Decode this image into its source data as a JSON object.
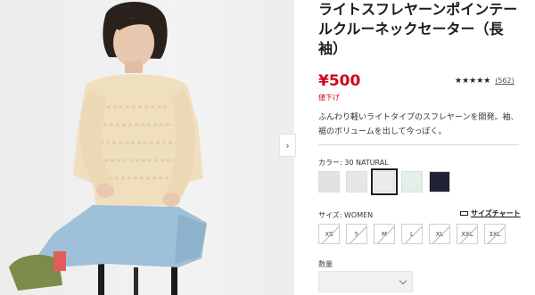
{
  "product": {
    "title": "ライトスフレヤーンポインテールクルーネックセーター（長袖）",
    "price": "¥500",
    "price_tag": "値下げ",
    "rating_stars": "★★★★★",
    "rating_count": "(562)",
    "description": "ふんわり軽いライトタイプのスフレヤーンを開発。袖、裾のボリュームを出して今っぽく。"
  },
  "color": {
    "label": "カラー: 30 NATURAL",
    "swatches": [
      "#e2e2e2",
      "#e7e7e7",
      "#ebebeb",
      "#e3f0ea",
      "#1f2335"
    ],
    "selected_index": 2
  },
  "size": {
    "label": "サイズ: WOMEN",
    "chart_link": "サイズチャート",
    "options": [
      "XS",
      "S",
      "M",
      "L",
      "XL",
      "XXL",
      "3XL"
    ]
  },
  "quantity": {
    "label": "数量"
  },
  "gallery": {
    "next_icon": "chevron-right-icon",
    "next_glyph": "›"
  }
}
